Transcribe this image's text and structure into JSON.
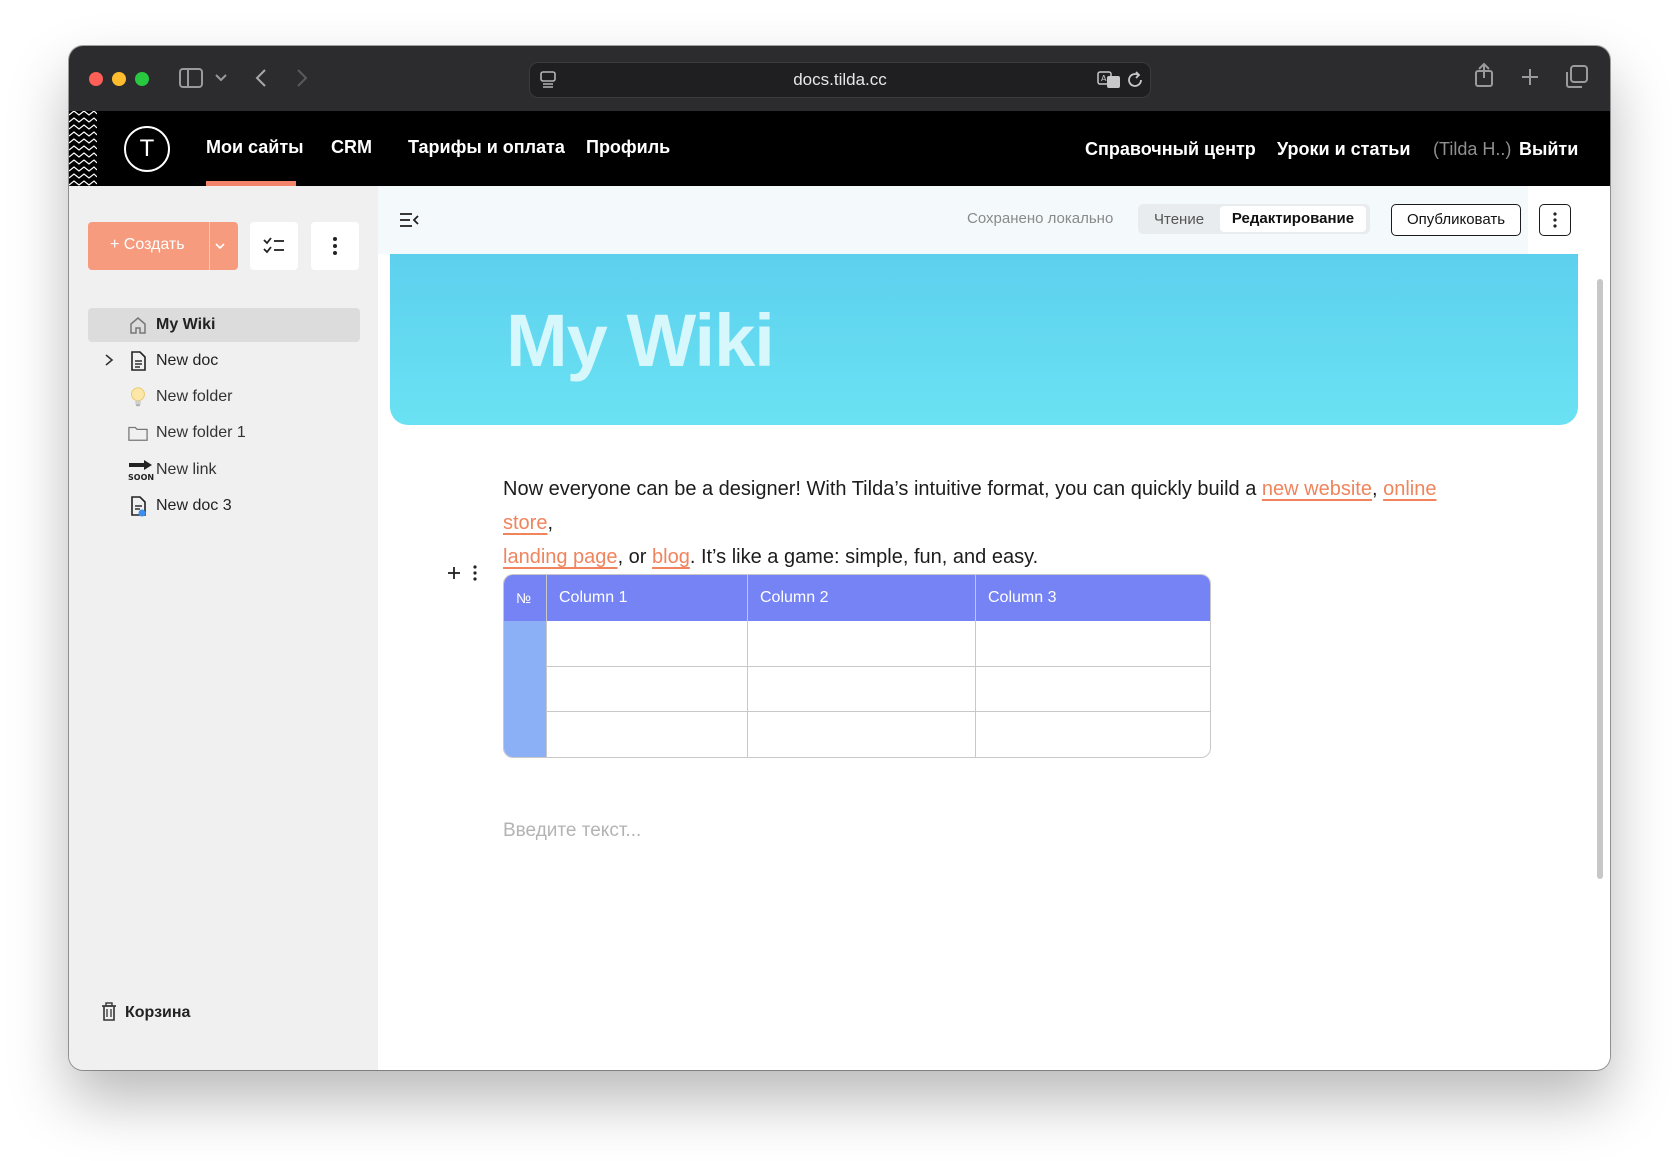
{
  "browser": {
    "url": "docs.tilda.cc"
  },
  "nav": {
    "logo": "T",
    "items": [
      "Мои сайты",
      "CRM",
      "Тарифы и оплата",
      "Профиль"
    ],
    "right_items": [
      "Справочный центр",
      "Уроки и статьи"
    ],
    "user": "(Tilda H..)",
    "logout": "Выйти"
  },
  "sidebar": {
    "create_label": "+ Создать",
    "tree": [
      {
        "label": "My Wiki",
        "icon": "home-icon"
      },
      {
        "label": "New doc",
        "icon": "document-icon"
      },
      {
        "label": "New folder",
        "icon": "lightbulb-icon"
      },
      {
        "label": "New folder 1",
        "icon": "folder-icon"
      },
      {
        "label": "New link",
        "icon": "soon-arrow-icon"
      },
      {
        "label": "New doc 3",
        "icon": "document-dot-icon"
      }
    ],
    "trash": "Корзина"
  },
  "editor": {
    "saved_status": "Сохранено локально",
    "mode_reading": "Чтение",
    "mode_editing": "Редактирование",
    "publish": "Опубликовать",
    "title": "My Wiki",
    "para_1": "Now everyone can be a designer! With Tilda’s intuitive format, you can quickly build a ",
    "link_1": "new website",
    "sep_1": ", ",
    "link_2": "online store",
    "sep_2": ",",
    "link_3": "landing page",
    "sep_3": ", or ",
    "link_4": "blog",
    "para_2": ". It’s like a game: simple, fun, and easy.",
    "placeholder": "Введите текст..."
  },
  "table": {
    "headers": [
      "№",
      "Column 1",
      "Column 2",
      "Column 3"
    ]
  },
  "colors": {
    "accent": "#f69b7e",
    "banner": "#5dd0ee",
    "table_header": "#7683f4",
    "link": "#f0845d"
  }
}
